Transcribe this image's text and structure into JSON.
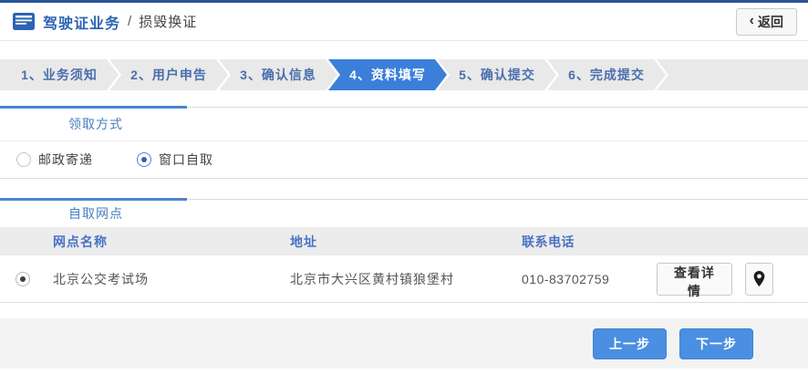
{
  "header": {
    "title_primary": "驾驶证业务",
    "title_separator": "/",
    "title_secondary": "损毁换证",
    "back": {
      "chevron": "‹",
      "label": "返回"
    }
  },
  "steps": {
    "items": [
      {
        "label": "1、业务须知",
        "active": false
      },
      {
        "label": "2、用户申告",
        "active": false
      },
      {
        "label": "3、确认信息",
        "active": false
      },
      {
        "label": "4、资料填写",
        "active": true
      },
      {
        "label": "5、确认提交",
        "active": false
      },
      {
        "label": "6、完成提交",
        "active": false
      }
    ]
  },
  "pickup_method": {
    "section_title": "领取方式",
    "options": [
      {
        "label": "邮政寄递",
        "selected": false
      },
      {
        "label": "窗口自取",
        "selected": true
      }
    ]
  },
  "pickup_locations": {
    "section_title": "自取网点",
    "table": {
      "headers": [
        "网点名称",
        "地址",
        "联系电话"
      ],
      "rows": [
        {
          "selected": true,
          "name": "北京公交考试场",
          "address": "北京市大兴区黄村镇狼堡村",
          "phone": "010-83702759",
          "detail_button_label": "查看详情",
          "map_icon": "location-pin"
        }
      ]
    }
  },
  "footer": {
    "prev_label": "上一步",
    "next_label": "下一步"
  },
  "colors": {
    "top_bar_blue": "#28549c",
    "title_blue": "#2d64b3",
    "step_active_blue": "#3b7fd9",
    "step_text_blue": "#4a6fad",
    "tab_line_blue": "#4a86cd",
    "table_header_blue": "#4a72c4",
    "button_blue": "#4a8fe2"
  }
}
